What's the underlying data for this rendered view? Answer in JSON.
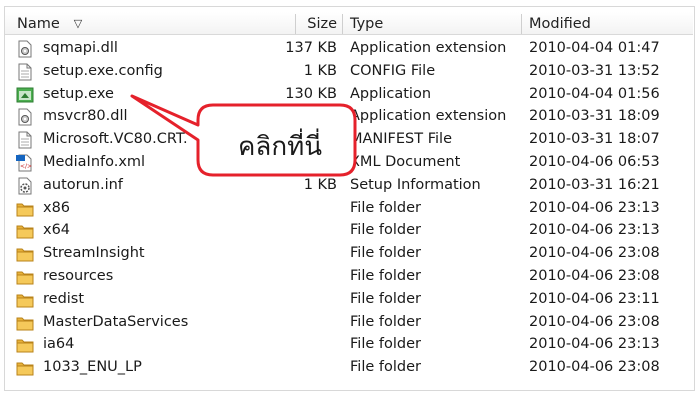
{
  "columns": {
    "name": "Name",
    "size": "Size",
    "type": "Type",
    "modified": "Modified"
  },
  "files": [
    {
      "name": "sqmapi.dll",
      "size": "137 KB",
      "type": "Application extension",
      "modified": "2010-04-04 01:47",
      "icon": "dll-icon"
    },
    {
      "name": "setup.exe.config",
      "size": "1 KB",
      "type": "CONFIG File",
      "modified": "2010-03-31 13:52",
      "icon": "document-icon"
    },
    {
      "name": "setup.exe",
      "size": "130 KB",
      "type": "Application",
      "modified": "2010-04-04 01:56",
      "icon": "application-icon"
    },
    {
      "name": "msvcr80.dll",
      "size": "",
      "type": "Application extension",
      "modified": "2010-03-31 18:09",
      "icon": "dll-icon"
    },
    {
      "name": "Microsoft.VC80.CRT.",
      "size": "",
      "type": "MANIFEST File",
      "modified": "2010-03-31 18:07",
      "icon": "document-icon"
    },
    {
      "name": "MediaInfo.xml",
      "size": "",
      "type": "XML Document",
      "modified": "2010-04-06 06:53",
      "icon": "xml-icon"
    },
    {
      "name": "autorun.inf",
      "size": "1 KB",
      "type": "Setup Information",
      "modified": "2010-03-31 16:21",
      "icon": "setup-info-icon"
    },
    {
      "name": "x86",
      "size": "",
      "type": "File folder",
      "modified": "2010-04-06 23:13",
      "icon": "folder-icon"
    },
    {
      "name": "x64",
      "size": "",
      "type": "File folder",
      "modified": "2010-04-06 23:13",
      "icon": "folder-icon"
    },
    {
      "name": "StreamInsight",
      "size": "",
      "type": "File folder",
      "modified": "2010-04-06 23:08",
      "icon": "folder-icon"
    },
    {
      "name": "resources",
      "size": "",
      "type": "File folder",
      "modified": "2010-04-06 23:08",
      "icon": "folder-icon"
    },
    {
      "name": "redist",
      "size": "",
      "type": "File folder",
      "modified": "2010-04-06 23:11",
      "icon": "folder-icon"
    },
    {
      "name": "MasterDataServices",
      "size": "",
      "type": "File folder",
      "modified": "2010-04-06 23:08",
      "icon": "folder-icon"
    },
    {
      "name": "ia64",
      "size": "",
      "type": "File folder",
      "modified": "2010-04-06 23:13",
      "icon": "folder-icon"
    },
    {
      "name": "1033_ENU_LP",
      "size": "",
      "type": "File folder",
      "modified": "2010-04-06 23:08",
      "icon": "folder-icon"
    }
  ],
  "callout": {
    "text": "คลิกที่นี่",
    "border_color": "#e5212b"
  }
}
